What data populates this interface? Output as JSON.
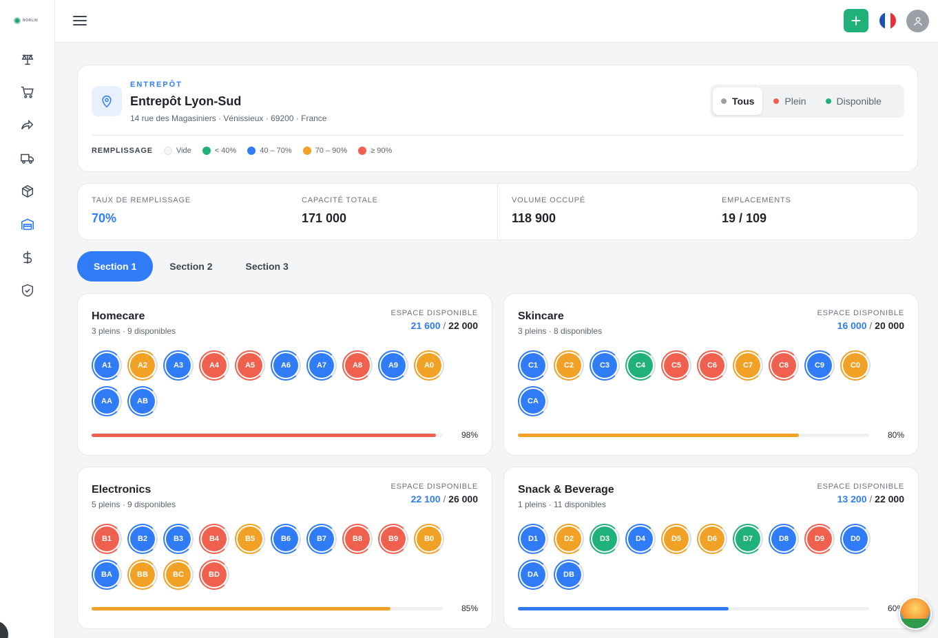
{
  "app": {
    "logo_text": "NORLIN"
  },
  "colors": {
    "primary": "#2f7cf6",
    "green": "#20b07a",
    "blue": "#2f7cf6",
    "orange": "#f0a126",
    "red": "#f0604f",
    "empty": "#e9eaec"
  },
  "nav": [
    "dashboard-icon",
    "cart-icon",
    "forward-icon",
    "truck-icon",
    "box-icon",
    "warehouse-icon",
    "dollar-icon",
    "shield-icon"
  ],
  "warehouse": {
    "kicker": "ENTREPÔT",
    "name": "Entrepôt Lyon-Sud",
    "address": "14 rue des Magasiniers · Vénissieux · 69200 · France"
  },
  "filter": {
    "all": "Tous",
    "full": "Plein",
    "available": "Disponible"
  },
  "legend": {
    "title": "REMPLISSAGE",
    "empty": "Vide",
    "low": "< 40%",
    "mid": "40 – 70%",
    "high": "70 – 90%",
    "full": "≥ 90%"
  },
  "stats": {
    "fill_rate_label": "TAUX DE REMPLISSAGE",
    "fill_rate": "70%",
    "capacity_label": "CAPACITÉ TOTALE",
    "capacity": "171 000",
    "volume_label": "VOLUME OCCUPÉ",
    "volume": "118 900",
    "locations_label": "EMPLACEMENTS",
    "locations": "19 / 109"
  },
  "tabs": [
    "Section 1",
    "Section 2",
    "Section 3"
  ],
  "space_label": "ESPACE DISPONIBLE",
  "sections": [
    {
      "title": "Homecare",
      "sub": "3 pleins · 9 disponibles",
      "available": "21 600",
      "total": "22 000",
      "pct_label": "98%",
      "pct": 0.98,
      "bar_color": "red",
      "slots": [
        [
          "A1",
          "blue"
        ],
        [
          "A2",
          "orange"
        ],
        [
          "A3",
          "blue"
        ],
        [
          "A4",
          "red"
        ],
        [
          "A5",
          "red"
        ],
        [
          "A6",
          "blue"
        ],
        [
          "A7",
          "blue"
        ],
        [
          "A8",
          "red"
        ],
        [
          "A9",
          "blue"
        ],
        [
          "A0",
          "orange"
        ],
        [
          "AA",
          "blue"
        ],
        [
          "AB",
          "blue"
        ]
      ]
    },
    {
      "title": "Skincare",
      "sub": "3 pleins · 8 disponibles",
      "available": "16 000",
      "total": "20 000",
      "pct_label": "80%",
      "pct": 0.8,
      "bar_color": "orange",
      "slots": [
        [
          "C1",
          "blue"
        ],
        [
          "C2",
          "orange"
        ],
        [
          "C3",
          "blue"
        ],
        [
          "C4",
          "green"
        ],
        [
          "C5",
          "red"
        ],
        [
          "C6",
          "red"
        ],
        [
          "C7",
          "orange"
        ],
        [
          "C8",
          "red"
        ],
        [
          "C9",
          "blue"
        ],
        [
          "C0",
          "orange"
        ],
        [
          "CA",
          "blue"
        ]
      ]
    },
    {
      "title": "Electronics",
      "sub": "5 pleins · 9 disponibles",
      "available": "22 100",
      "total": "26 000",
      "pct_label": "85%",
      "pct": 0.85,
      "bar_color": "orange",
      "slots": [
        [
          "B1",
          "red"
        ],
        [
          "B2",
          "blue"
        ],
        [
          "B3",
          "blue"
        ],
        [
          "B4",
          "red"
        ],
        [
          "B5",
          "orange"
        ],
        [
          "B6",
          "blue"
        ],
        [
          "B7",
          "blue"
        ],
        [
          "B8",
          "red"
        ],
        [
          "B9",
          "red"
        ],
        [
          "B0",
          "orange"
        ],
        [
          "BA",
          "blue"
        ],
        [
          "BB",
          "orange"
        ],
        [
          "BC",
          "orange"
        ],
        [
          "BD",
          "red"
        ]
      ]
    },
    {
      "title": "Snack & Beverage",
      "sub": "1 pleins · 11 disponibles",
      "available": "13 200",
      "total": "22 000",
      "pct_label": "60%",
      "pct": 0.6,
      "bar_color": "blue",
      "slots": [
        [
          "D1",
          "blue"
        ],
        [
          "D2",
          "orange"
        ],
        [
          "D3",
          "green"
        ],
        [
          "D4",
          "blue"
        ],
        [
          "D5",
          "orange"
        ],
        [
          "D6",
          "orange"
        ],
        [
          "D7",
          "green"
        ],
        [
          "D8",
          "blue"
        ],
        [
          "D9",
          "red"
        ],
        [
          "D0",
          "blue"
        ],
        [
          "DA",
          "blue"
        ],
        [
          "DB",
          "blue"
        ]
      ]
    }
  ]
}
